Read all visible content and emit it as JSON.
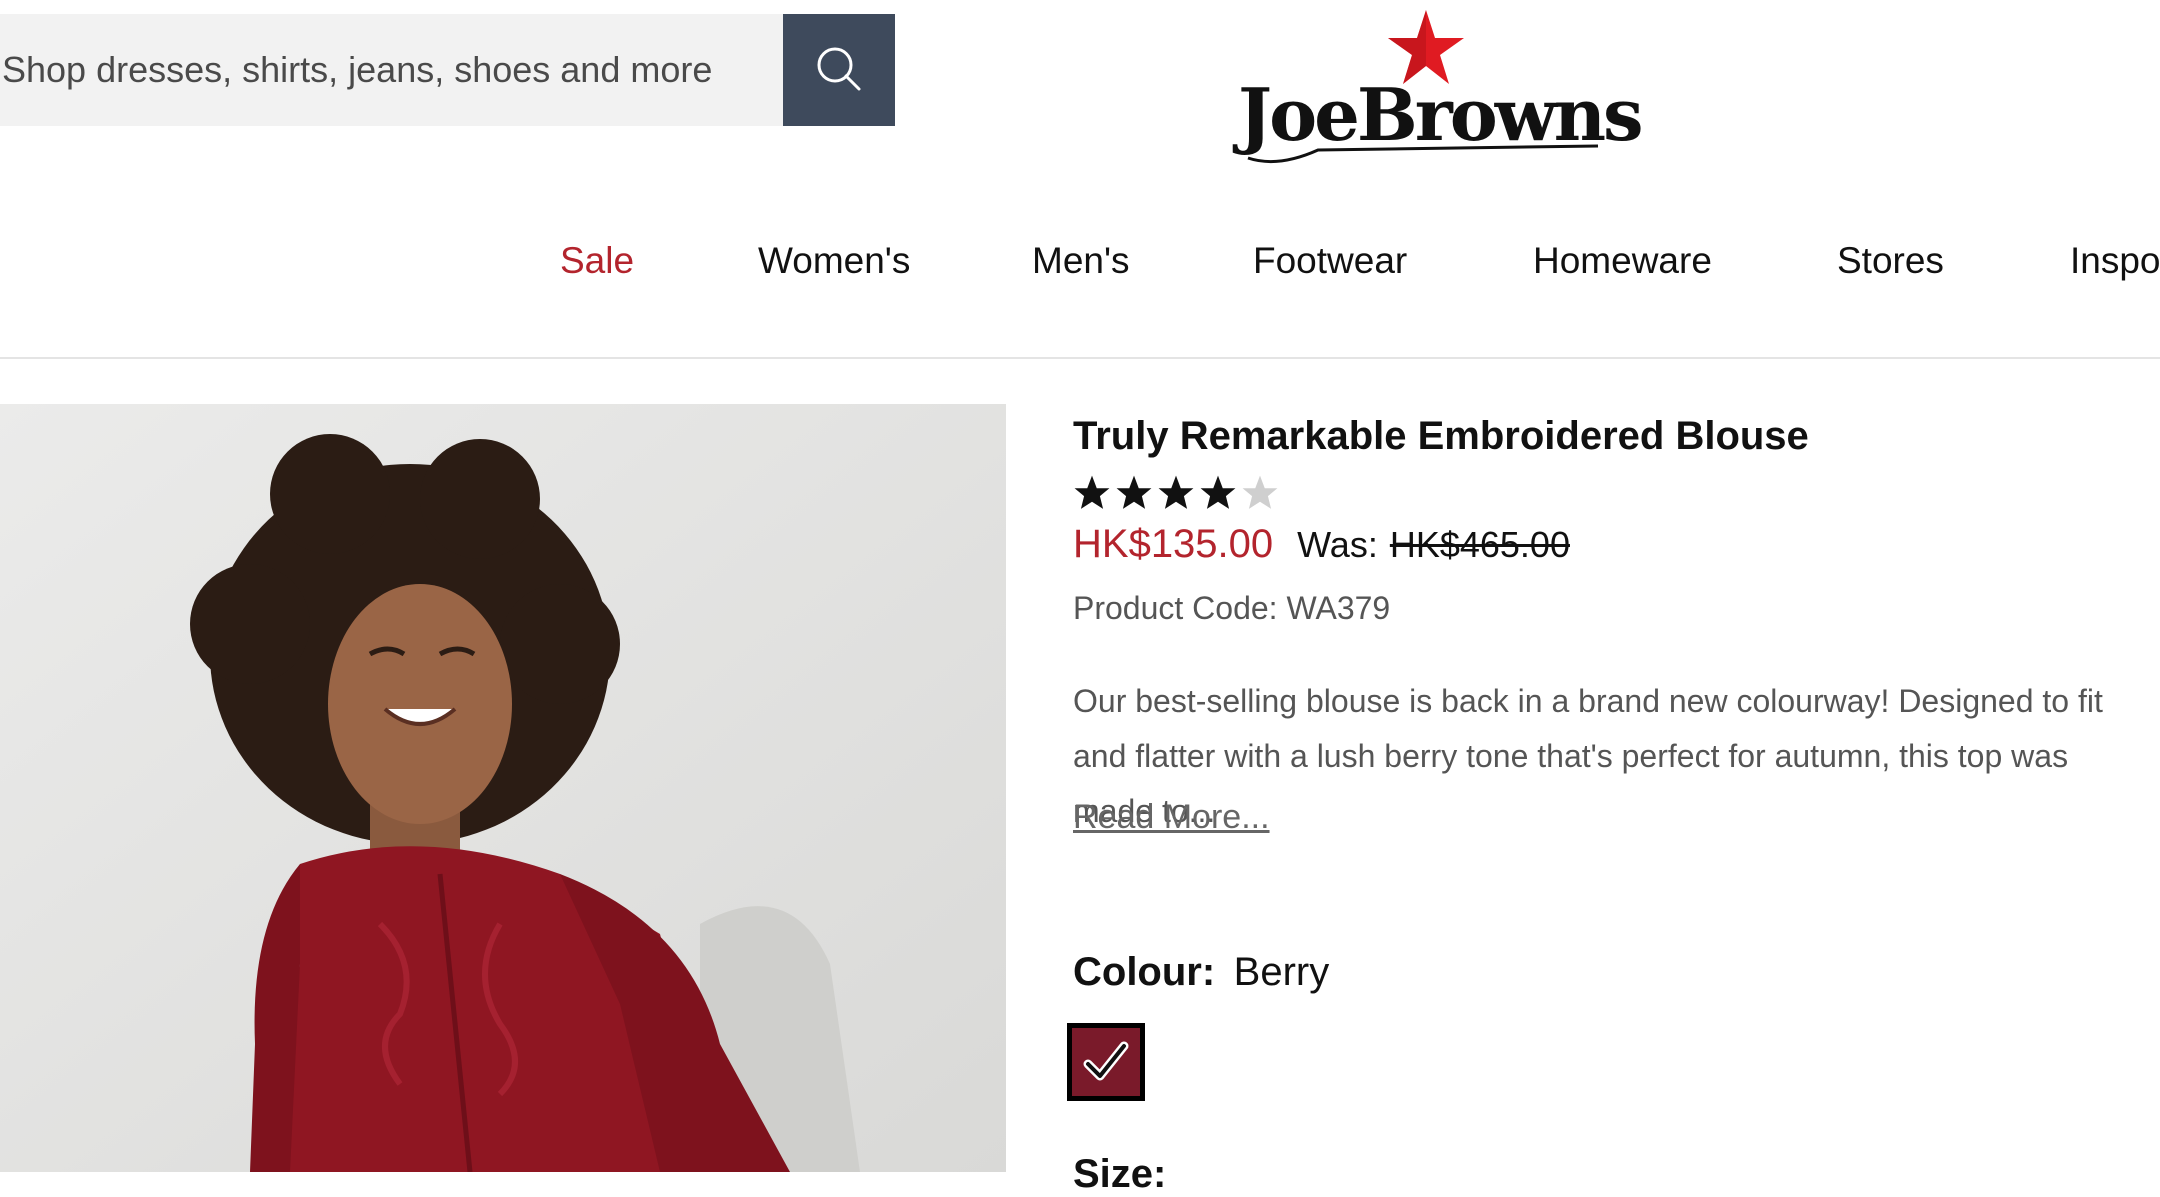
{
  "search": {
    "placeholder": "Shop dresses, shirts, jeans, shoes and more"
  },
  "brand": {
    "logo_text": "JoeBrowns",
    "accent": "#e01b22"
  },
  "nav": {
    "items": [
      {
        "label": "Sale"
      },
      {
        "label": "Women's"
      },
      {
        "label": "Men's"
      },
      {
        "label": "Footwear"
      },
      {
        "label": "Homeware"
      },
      {
        "label": "Stores"
      },
      {
        "label": "Inspo"
      }
    ]
  },
  "product": {
    "title": "Truly Remarkable Embroidered Blouse",
    "rating": 4,
    "rating_max": 5,
    "price": "HK$135.00",
    "was_label": "Was:",
    "was_price": "HK$465.00",
    "code": "Product Code: WA379",
    "description": "Our best-selling blouse is back in a brand new colourway! Designed to fit and flatter with a lush berry tone that's perfect for autumn, this top was made to...",
    "read_more": "Read More...",
    "colour_label": "Colour:",
    "colour_value": "Berry",
    "swatch_color": "#7a1a2a",
    "size_label": "Size:"
  },
  "colors": {
    "sale": "#b3242d",
    "search_button": "#3e4a5c"
  }
}
